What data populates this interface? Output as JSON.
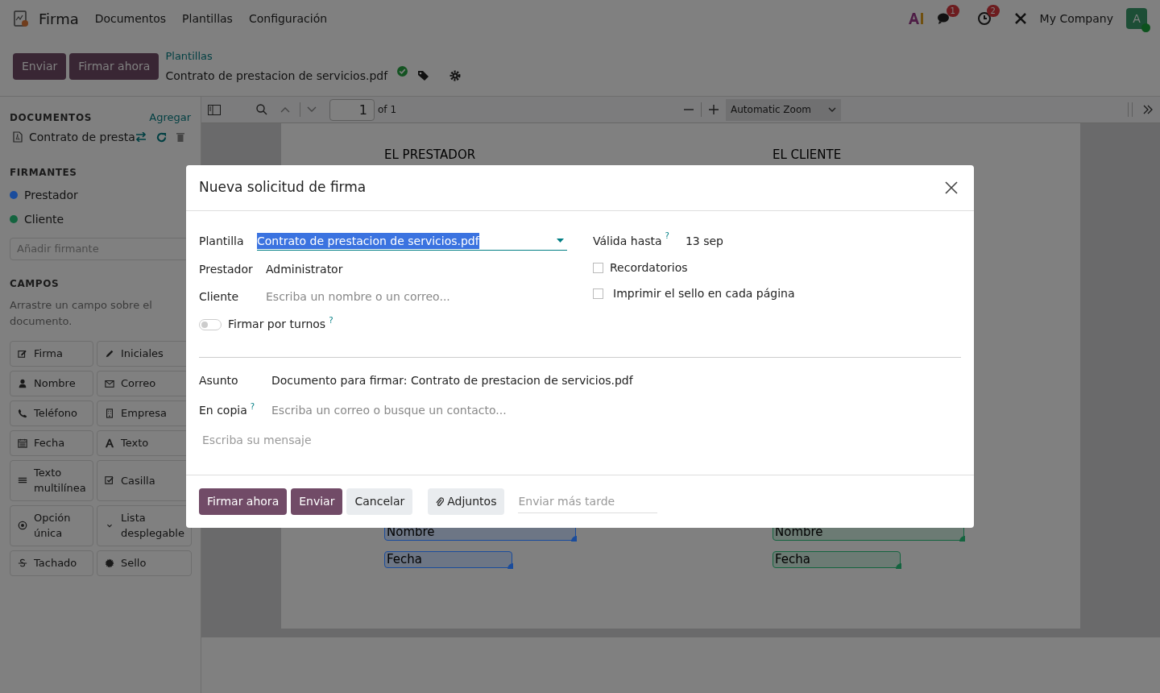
{
  "navbar": {
    "app_name": "Firma",
    "menu": [
      "Documentos",
      "Plantillas",
      "Configuración"
    ],
    "messages_badge": "1",
    "activities_badge": "2",
    "company": "My Company",
    "avatar_initial": "A"
  },
  "control_panel": {
    "buttons": [
      "Enviar",
      "Firmar ahora"
    ],
    "breadcrumb": "Plantillas",
    "title": "Contrato de prestacion de servicios.pdf"
  },
  "sidebar": {
    "documents_title": "DOCUMENTOS",
    "add_label": "Agregar",
    "document": "Contrato de presta",
    "signers_title": "FIRMANTES",
    "signers": [
      {
        "name": "Prestador",
        "color": "#1a4c9c"
      },
      {
        "name": "Cliente",
        "color": "#14643f"
      }
    ],
    "add_signer_placeholder": "Añadir firmante",
    "fields_title": "CAMPOS",
    "fields_hint": "Arrastre un campo sobre el documento.",
    "fields": [
      "Firma",
      "Iniciales",
      "Nombre",
      "Correo",
      "Teléfono",
      "Empresa",
      "Fecha",
      "Texto",
      "Texto multilínea",
      "Casilla",
      "Opción única",
      "Lista desplegable",
      "Tachado",
      "Sello"
    ]
  },
  "viewer": {
    "page": "1",
    "page_count": "of 1",
    "zoom": "Automatic Zoom"
  },
  "document": {
    "headings": [
      "EL PRESTADOR",
      "EL CLIENTE"
    ],
    "columns": [
      {
        "color": "#1a4c9c",
        "boxes": [
          "Nombre",
          "Fecha"
        ]
      },
      {
        "color": "#14643f",
        "boxes": [
          "Nombre",
          "Fecha"
        ]
      }
    ]
  },
  "dialog": {
    "title": "Nueva solicitud de firma",
    "template_label": "Plantilla",
    "template_value": "Contrato de prestacion de servicios.pdf",
    "signer_rows": [
      {
        "label": "Prestador",
        "value": "Administrator"
      },
      {
        "label": "Cliente",
        "placeholder": "Escriba un nombre o un correo..."
      }
    ],
    "turns": {
      "label": "Firmar por turnos",
      "help": "?",
      "on": false
    },
    "valid_label": "Válida hasta",
    "valid_help": "?",
    "valid_value": "13 sep",
    "options": [
      {
        "label": "Recordatorios",
        "checked": false
      },
      {
        "label": "Imprimir el sello en cada página",
        "checked": false
      }
    ],
    "subject_label": "Asunto",
    "subject_value": "Documento para firmar: Contrato de prestacion de servicios.pdf",
    "cc_label": "En copia",
    "cc_help": "?",
    "cc_placeholder": "Escriba un correo o busque un contacto...",
    "message_placeholder": "Escriba su mensaje",
    "buttons": [
      {
        "label": "Firmar ahora",
        "kind": "primary"
      },
      {
        "label": "Enviar",
        "kind": "primary"
      },
      {
        "label": "Cancelar",
        "kind": "secondary"
      }
    ],
    "attachments": "Adjuntos",
    "send_later_placeholder": "Enviar más tarde"
  }
}
